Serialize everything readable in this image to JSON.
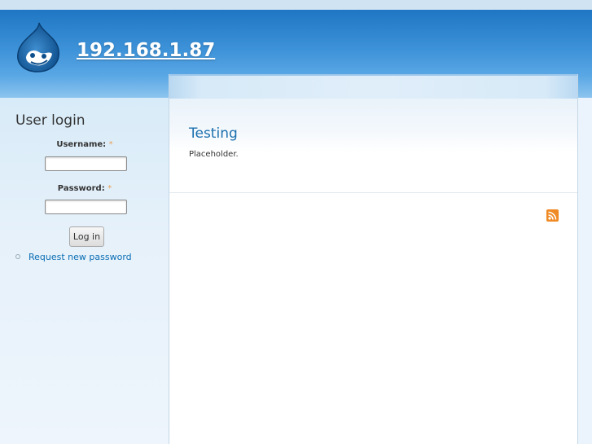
{
  "site": {
    "name": "192.168.1.87",
    "logo_icon": "drupal-drop-icon"
  },
  "sidebar": {
    "block_title": "User login",
    "username_label": "Username:",
    "password_label": "Password:",
    "required_marker": "*",
    "username_value": "",
    "password_value": "",
    "login_button": "Log in",
    "links": [
      {
        "label": "Request new password"
      }
    ]
  },
  "main": {
    "node_title": "Testing",
    "node_body": "Placeholder.",
    "feed_icon": "rss-feed-icon"
  },
  "colors": {
    "header_blue": "#2b80c9",
    "link_blue": "#1b6fae",
    "required_orange": "#e8a15a",
    "rss_orange": "#f08a24"
  }
}
